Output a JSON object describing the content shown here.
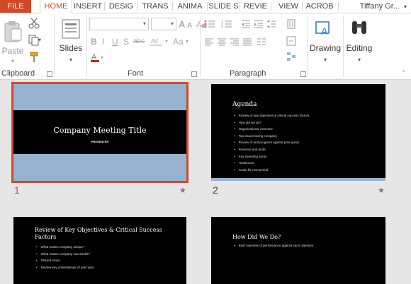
{
  "tabs": [
    {
      "label": "FILE"
    },
    {
      "label": "HOME"
    },
    {
      "label": "INSERT"
    },
    {
      "label": "DESIG"
    },
    {
      "label": "TRANS"
    },
    {
      "label": "ANIMA"
    },
    {
      "label": "SLIDE S"
    },
    {
      "label": "REVIE"
    },
    {
      "label": "VIEW"
    },
    {
      "label": "ACROB"
    }
  ],
  "user": {
    "name": "Tiffany Gr..."
  },
  "ribbon": {
    "clipboard": {
      "paste_label": "Paste",
      "group_label": "Clipboard"
    },
    "slides": {
      "label": "Slides"
    },
    "font": {
      "group_label": "Font",
      "size_up": "A",
      "size_down": "A",
      "case": "Aa"
    },
    "paragraph": {
      "group_label": "Paragraph"
    },
    "drawing": {
      "label": "Drawing"
    },
    "editing": {
      "label": "Editing"
    }
  },
  "slides": [
    {
      "number": "1",
      "title": "Company Meeting Title",
      "subtitle": "PRESENTER"
    },
    {
      "number": "2",
      "title": "Agenda",
      "bullets": [
        "Review of key objectives & critical success factors.",
        "How did we do?",
        "Organizational overview",
        "Top issues facing company.",
        "Review of and progress against prior goals.",
        "Revenue and profit",
        "Key spending areas",
        "Headcount",
        "Goals for next period"
      ]
    },
    {
      "title": "Review of Key Objectives & Critical Success Factors",
      "bullets": [
        "What makes company unique?",
        "What makes company successful?",
        "Shared vision",
        "Review key undertakings of past year."
      ]
    },
    {
      "title": "How Did We Do?",
      "bullets": [
        "Brief overview of performance against each objective."
      ]
    }
  ],
  "colors": {
    "accent": "#d24726",
    "title_band_bg": "#96b4d2"
  }
}
